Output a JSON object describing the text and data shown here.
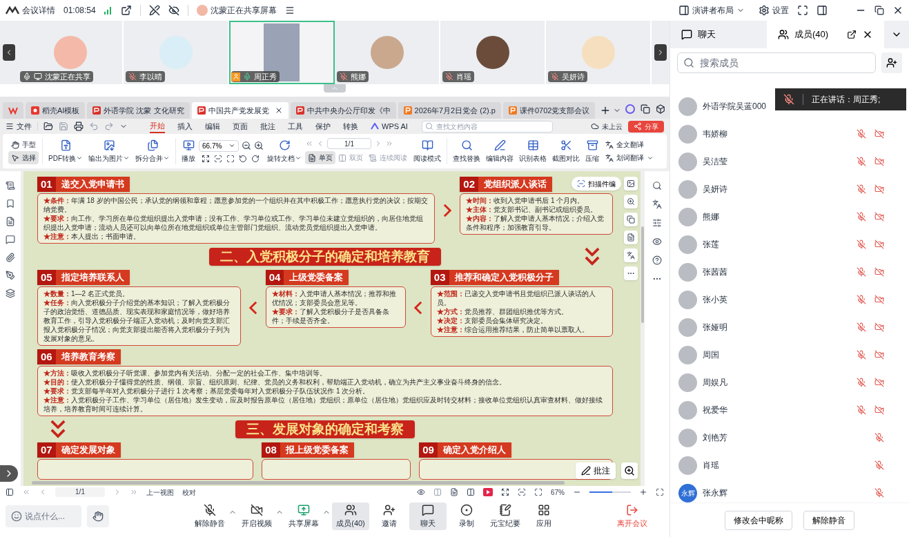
{
  "topbar": {
    "title": "会议详情",
    "timer": "01:08:54",
    "sharing": "沈蒙正在共享屏幕",
    "layout": "演讲者布局",
    "settings": "设置"
  },
  "videos": [
    {
      "name": "沈蒙正在共享",
      "selected": false,
      "host": false,
      "muted": false,
      "speaking": false,
      "sharing": true
    },
    {
      "name": "李以晴",
      "selected": false,
      "host": false,
      "muted": true,
      "speaking": false,
      "sharing": false
    },
    {
      "name": "周正秀",
      "selected": true,
      "host": true,
      "muted": false,
      "speaking": true,
      "sharing": false
    },
    {
      "name": "熊娜",
      "selected": false,
      "host": false,
      "muted": true,
      "speaking": false,
      "sharing": false
    },
    {
      "name": "肖瑶",
      "selected": false,
      "host": false,
      "muted": true,
      "speaking": false,
      "sharing": false
    },
    {
      "name": "吴妍诗",
      "selected": false,
      "host": false,
      "muted": true,
      "speaking": false,
      "sharing": false
    }
  ],
  "wps": {
    "tabs": [
      {
        "kind": "ai",
        "label": "稻壳AI模板",
        "selected": false
      },
      {
        "kind": "pdf",
        "label": "外语学院 沈蒙 文化研究",
        "selected": false
      },
      {
        "kind": "pdf",
        "label": "中国共产党发展党",
        "selected": true
      },
      {
        "kind": "pdf",
        "label": "中共中央办公厅印发《中",
        "selected": false
      },
      {
        "kind": "ppt",
        "label": "2026年7月2日党会 (2).p",
        "selected": false
      },
      {
        "kind": "ppt",
        "label": "课件0702党支部会议",
        "selected": false
      }
    ],
    "file": "文件",
    "menu_tabs": [
      {
        "label": "开始",
        "selected": true
      },
      {
        "label": "插入",
        "selected": false
      },
      {
        "label": "编辑",
        "selected": false
      },
      {
        "label": "页面",
        "selected": false
      },
      {
        "label": "批注",
        "selected": false
      },
      {
        "label": "工具",
        "selected": false
      },
      {
        "label": "保护",
        "selected": false
      },
      {
        "label": "转换",
        "selected": false
      }
    ],
    "ai": "WPS AI",
    "search_placeholder": "查找文档内容",
    "cloud": "未上云",
    "share": "分享",
    "ribbon": {
      "hand": {
        "label": "手型",
        "selected": false
      },
      "select": {
        "label": "选择",
        "selected": true
      },
      "pdf_convert": "PDF转换",
      "to_image": "输出为图片",
      "split_merge": "拆分合并",
      "play": "播放",
      "zoom": "66.7%",
      "rotate": "旋转文档",
      "page": "1/1",
      "single": {
        "label": "单页",
        "selected": true
      },
      "double": {
        "label": "双页",
        "disabled": true
      },
      "continuous": {
        "label": "连续阅读",
        "disabled": true
      },
      "read_mode": "阅读模式",
      "find": "查找替换",
      "edit": "编辑内容",
      "table": "识别表格",
      "compare": "截图对比",
      "compress": "压缩",
      "translate_all": "全文翻译",
      "translate_word": "划词翻译"
    },
    "scan_edit": "扫描件编",
    "poster": [
      {
        "kind": "steps_right",
        "steps": [
          {
            "num": "01",
            "title": "递交入党申请书",
            "items": [
              "**★条件：**年满 18 岁的中国公民；承认党的纲领和章程；愿意参加党的一个组织并在其中积极工作；愿意执行党的决议；按期交纳党费。",
              "**★要求：**向工作、学习所在单位党组织提出入党申请；没有工作、学习单位或工作、学习单位未建立党组织的，向居住地党组织提出入党申请；流动人员还可以向单位所在地党组织或单位主管部门党组织、流动党员党组织提出入党申请。",
              "**★注意：**本人提出；书面申请。"
            ]
          },
          {
            "num": "02",
            "title": "党组织派人谈话",
            "items": [
              "**★时间：**收到入党申请书后 1 个月内。",
              "**★主体：**党支部书记、副书记或组织委员。",
              "**★内容：**了解入党申请人基本情况；介绍入党条件和程序；加强教育引导。"
            ]
          }
        ]
      },
      {
        "kind": "title_arrow_right",
        "text": "二、入党积极分子的确定和培养教育"
      },
      {
        "kind": "steps_left",
        "steps": [
          {
            "num": "05",
            "title": "指定培养联系人",
            "items": [
              "**★数量：**1—2 名正式党员。",
              "**★任务：**向入党积极分子介绍党的基本知识；了解入党积极分子的政治觉悟、道德品质、现实表现和家庭情况等，做好培养教育工作，引导入党积极分子端正入党动机；及时向党支部汇报入党积极分子情况；向党支部提出能否将入党积极分子列为发展对象的意见。"
            ]
          },
          {
            "num": "04",
            "title": "上级党委备案",
            "items": [
              "**★材料：**入党申请人基本情况；推荐和推优情况；支部委员会意见等。",
              "**★要求：**了解入党积极分子是否具备条件；手续是否齐全。"
            ]
          },
          {
            "num": "03",
            "title": "推荐和确定入党积极分子",
            "items": [
              "**★范围：**已递交入党申请书且党组织已派人谈话的人员。",
              "**★方式：**党员推荐、群团组织推优等方式。",
              "**★决定：**支部委员会集体研究决定。",
              "**★注意：**综合运用推荐结果，防止简单以票取人。"
            ]
          }
        ]
      },
      {
        "kind": "steps",
        "steps": [
          {
            "num": "06",
            "title": "培养教育考察",
            "items": [
              "**★方法：**吸收入党积极分子听党课、参加党内有关活动、分配一定的社会工作、集中培训等。",
              "**★目的：**使入党积极分子懂得党的性质、纲领、宗旨、组织原则、纪律、党员的义务和权利，帮助端正入党动机，确立为共产主义事业奋斗终身的信念。",
              "**★要求：**党支部每半年对入党积极分子进行 1 次考察；基层党委每年对入党积极分子队伍状况作 1 次分析。",
              "**★注意：**入党积极分子工作、学习单位（居住地）发生变动，应及时报告原单位（居住地）党组织；原单位（居住地）党组织应及时转交材料；接收单位党组织认真审查材料、做好接续培养，培养教育时间可连续计算。"
            ]
          }
        ]
      },
      {
        "kind": "title_arrow_left",
        "text": "三、发展对象的确定和考察"
      },
      {
        "kind": "steps",
        "steps": [
          {
            "num": "07",
            "title": "确定发展对象"
          },
          {
            "num": "08",
            "title": "报上级党委备案"
          },
          {
            "num": "09",
            "title": "确定入党介绍人"
          }
        ]
      }
    ],
    "status": {
      "page": "1/1",
      "prev_view": "上一视图",
      "proofread": "校对",
      "zoom": "67%",
      "level": 0.55
    },
    "comment": "批注"
  },
  "toolbar": {
    "chat_placeholder": "说点什么...",
    "controls": [
      {
        "kind": "mic",
        "label": "解除静音",
        "menu": true,
        "selected": false
      },
      {
        "kind": "video",
        "label": "开启视频",
        "menu": true,
        "selected": false
      },
      {
        "kind": "share",
        "label": "共享屏幕",
        "menu": true,
        "selected": false
      },
      {
        "kind": "members",
        "label": "成员(40)",
        "menu": false,
        "selected": true
      },
      {
        "kind": "invite",
        "label": "邀请",
        "menu": false,
        "selected": false
      },
      {
        "kind": "chat",
        "label": "聊天",
        "menu": false,
        "selected": true
      },
      {
        "kind": "record",
        "label": "录制",
        "menu": false,
        "selected": false
      },
      {
        "kind": "notes",
        "label": "元宝纪要",
        "menu": false,
        "selected": false
      },
      {
        "kind": "apps",
        "label": "应用",
        "menu": false,
        "selected": false
      }
    ],
    "leave": "离开会议"
  },
  "panel": {
    "tabs": [
      {
        "label": "聊天",
        "selected": false
      },
      {
        "label": "成员(40)",
        "selected": true
      }
    ],
    "search_placeholder": "搜索成员",
    "toast": "正在讲话：周正秀;",
    "members": [
      {
        "name": "外语学院吴蓝000"
      },
      {
        "name": "韦娇柳",
        "mic_off": true,
        "cam_off": true
      },
      {
        "name": "吴洁莹",
        "mic_off": true,
        "cam_off": true
      },
      {
        "name": "吴妍诗",
        "mic_off": true,
        "cam_off": true
      },
      {
        "name": "熊娜",
        "mic_off": true,
        "cam_off": true
      },
      {
        "name": "张莲",
        "mic_off": true,
        "cam_off": true
      },
      {
        "name": "张茜茜",
        "mic_off": true,
        "cam_off": true
      },
      {
        "name": "张小英",
        "mic_off": true,
        "cam_off": true
      },
      {
        "name": "张娅明",
        "mic_off": true,
        "cam_off": true
      },
      {
        "name": "周国",
        "mic_off": true,
        "cam_off": true
      },
      {
        "name": "周娱凡",
        "mic_off": true,
        "cam_off": true
      },
      {
        "name": "祝爱华",
        "mic_off": true,
        "cam_off": true
      },
      {
        "name": "刘艳芳",
        "mic_off": true,
        "cam_off": false
      },
      {
        "name": "肖瑶",
        "mic_off": true,
        "cam_off": false
      },
      {
        "name": "张永辉",
        "avatar_text": "永辉",
        "mic_off": true,
        "cam_off": false
      }
    ],
    "buttons": [
      "修改会中昵称",
      "解除静音"
    ]
  }
}
